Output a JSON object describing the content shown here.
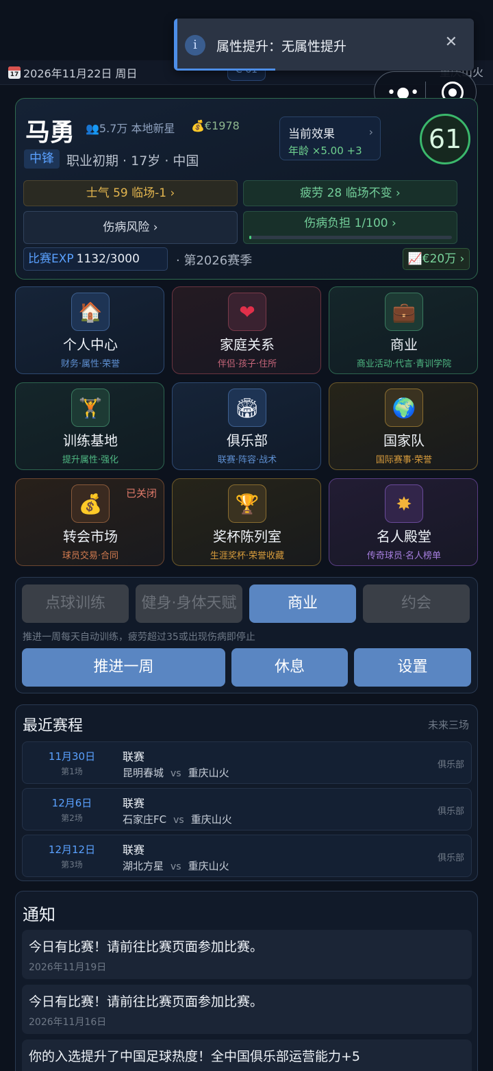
{
  "topbar": {
    "date": "2026年11月22日 周日",
    "calendar_day": "17",
    "ovr_chip": "C 61",
    "club": "重庆山火"
  },
  "toast": {
    "icon": "i",
    "text": "属性提升：无属性提升",
    "close": "✕"
  },
  "profile": {
    "name": "马勇",
    "fans": "5.7万 本地新星",
    "money": "€1978",
    "position": "中锋",
    "career": "职业初期 · 17岁 · 中国",
    "effect": {
      "title": "当前效果",
      "value": "年龄 ×5.00 +3"
    },
    "rating": "61",
    "morale": "士气 59 临场-1 ›",
    "fatigue": "疲劳 28 临场不变 ›",
    "injury_risk": "伤病风险 ›",
    "injury_burden": "伤病负担 1/100 ›",
    "injury_burden_fraction": 0.01,
    "exp_label": "比赛EXP",
    "exp_value": "1132/3000",
    "season": "· 第2026赛季",
    "market_value": "€20万 ›"
  },
  "tiles": [
    {
      "title": "个人中心",
      "sub": "财务·属性·荣誉",
      "icon": "house-icon",
      "glyph": "🏠"
    },
    {
      "title": "家庭关系",
      "sub": "伴侣·孩子·住所",
      "icon": "heart-icon",
      "glyph": "❤"
    },
    {
      "title": "商业",
      "sub": "商业活动·代言·青训学院",
      "icon": "briefcase-icon",
      "glyph": "💼"
    },
    {
      "title": "训练基地",
      "sub": "提升属性·强化",
      "icon": "athlete-icon",
      "glyph": "🏋"
    },
    {
      "title": "俱乐部",
      "sub": "联赛·阵容·战术",
      "icon": "stadium-icon",
      "glyph": "🏟"
    },
    {
      "title": "国家队",
      "sub": "国际赛事·荣誉",
      "icon": "globe-icon",
      "glyph": "🌍"
    },
    {
      "title": "转会市场",
      "sub": "球员交易·合同",
      "icon": "money-bag-icon",
      "glyph": "💰",
      "badge": "已关闭"
    },
    {
      "title": "奖杯陈列室",
      "sub": "生涯奖杯·荣誉收藏",
      "icon": "trophy-icon",
      "glyph": "🏆"
    },
    {
      "title": "名人殿堂",
      "sub": "传奇球员·名人榜单",
      "icon": "star-burst-icon",
      "glyph": "✸"
    }
  ],
  "actions": {
    "modes": [
      "点球训练",
      "健身·身体天赋",
      "商业",
      "约会"
    ],
    "hint": "推进一周每天自动训练，疲劳超过35或出现伤病即停止",
    "advance": "推进一周",
    "rest": "休息",
    "settings": "设置"
  },
  "schedule": {
    "title": "最近赛程",
    "subtitle": "未来三场",
    "matches": [
      {
        "date": "11月30日",
        "round": "第1场",
        "type": "联赛",
        "home": "昆明春城",
        "vs": "vs",
        "away": "重庆山火",
        "scope": "俱乐部"
      },
      {
        "date": "12月6日",
        "round": "第2场",
        "type": "联赛",
        "home": "石家庄FC",
        "vs": "vs",
        "away": "重庆山火",
        "scope": "俱乐部"
      },
      {
        "date": "12月12日",
        "round": "第3场",
        "type": "联赛",
        "home": "湖北方星",
        "vs": "vs",
        "away": "重庆山火",
        "scope": "俱乐部"
      }
    ]
  },
  "notifications": {
    "title": "通知",
    "items": [
      {
        "text": "今日有比赛！请前往比赛页面参加比赛。",
        "date": "2026年11月19日"
      },
      {
        "text": "今日有比赛！请前往比赛页面参加比赛。",
        "date": "2026年11月16日"
      },
      {
        "text": "你的入选提升了中国足球热度！全中国俱乐部运营能力+5",
        "date": ""
      }
    ]
  }
}
